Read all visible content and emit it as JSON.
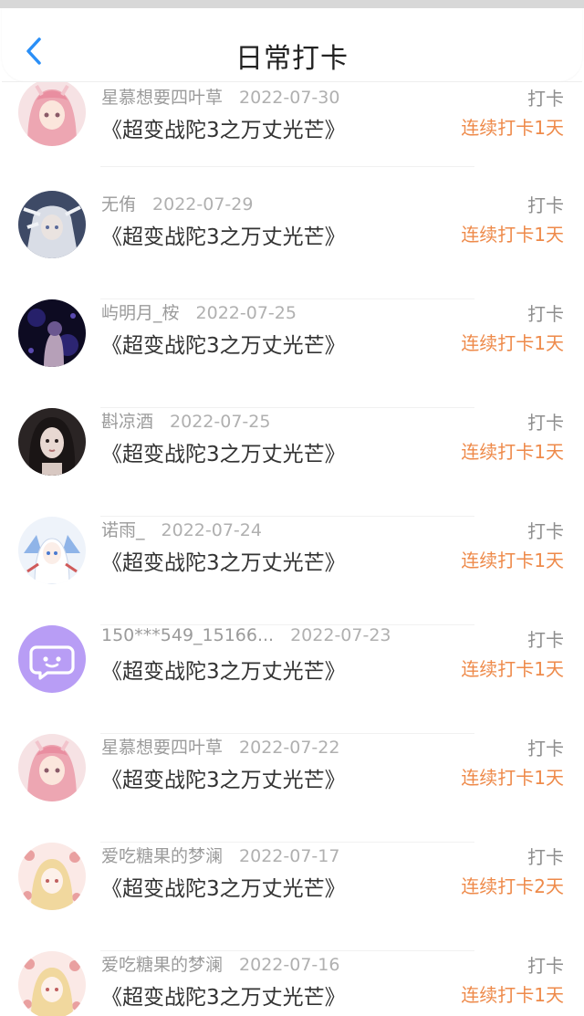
{
  "header": {
    "title": "日常打卡",
    "back_icon": "chevron-left-icon",
    "accent_color": "#2a8ff7"
  },
  "colors": {
    "streak": "#ee8a4a",
    "meta": "#9b9b9b"
  },
  "items": [
    {
      "user": "星慕想要四叶草",
      "date": "2022-07-30",
      "book": "《超变战陀3之万丈光芒》",
      "tag": "打卡",
      "streak": "连续打卡1天",
      "avatar": "anime-pink-hair-avatar"
    },
    {
      "user": "无侑",
      "date": "2022-07-29",
      "book": "《超变战陀3之万丈光芒》",
      "tag": "打卡",
      "streak": "连续打卡1天",
      "avatar": "anime-silver-hair-avatar"
    },
    {
      "user": "屿明月_桉",
      "date": "2022-07-25",
      "book": "《超变战陀3之万丈光芒》",
      "tag": "打卡",
      "streak": "连续打卡1天",
      "avatar": "dark-purple-avatar"
    },
    {
      "user": "斟凉酒",
      "date": "2022-07-25",
      "book": "《超变战陀3之万丈光芒》",
      "tag": "打卡",
      "streak": "连续打卡1天",
      "avatar": "photo-girl-avatar"
    },
    {
      "user": "诺雨_",
      "date": "2022-07-24",
      "book": "《超变战陀3之万丈光芒》",
      "tag": "打卡",
      "streak": "连续打卡1天",
      "avatar": "anime-white-avatar"
    },
    {
      "user": "150***549_15166...",
      "date": "2022-07-23",
      "book": "《超变战陀3之万丈光芒》",
      "tag": "打卡",
      "streak": "连续打卡1天",
      "avatar": "default-chat-avatar"
    },
    {
      "user": "星慕想要四叶草",
      "date": "2022-07-22",
      "book": "《超变战陀3之万丈光芒》",
      "tag": "打卡",
      "streak": "连续打卡1天",
      "avatar": "anime-pink-hair-avatar"
    },
    {
      "user": "爱吃糖果的梦澜",
      "date": "2022-07-17",
      "book": "《超变战陀3之万丈光芒》",
      "tag": "打卡",
      "streak": "连续打卡2天",
      "avatar": "anime-blonde-avatar"
    },
    {
      "user": "爱吃糖果的梦澜",
      "date": "2022-07-16",
      "book": "《超变战陀3之万丈光芒》",
      "tag": "打卡",
      "streak": "连续打卡1天",
      "avatar": "anime-blonde-avatar"
    }
  ]
}
